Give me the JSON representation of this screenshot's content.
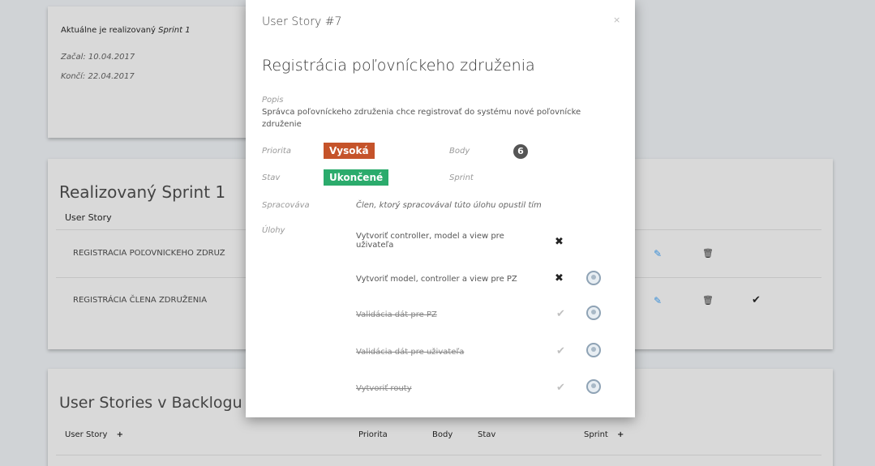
{
  "sprint_card": {
    "current_prefix": "Aktuálne je realizovaný",
    "current_sprint": "Sprint 1",
    "start": "Začal: 10.04.2017",
    "end": "Končí: 22.04.2017"
  },
  "realized": {
    "title": "Realizovaný Sprint 1",
    "col_user_story": "User Story",
    "rows": [
      {
        "name": "REGISTRÁCIA POĽOVNÍCKEHO ZDRUŽ",
        "edit": "edit-icon",
        "delete": "trash-icon",
        "check": ""
      },
      {
        "name": "REGISTRÁCIA ČLENA ZDRUŽENIA",
        "edit": "edit-icon",
        "delete": "trash-icon",
        "check": "✔"
      }
    ]
  },
  "backlog": {
    "title": "User Stories v Backlogu",
    "col_user_story": "User Story",
    "col_priority": "Priorita",
    "col_points": "Body",
    "col_state": "Stav",
    "col_sprint": "Sprint",
    "sort_icon": "+"
  },
  "modal": {
    "header": "User Story #7",
    "close": "×",
    "title": "Registrácia poľovníckeho združenia",
    "desc_label": "Popis",
    "desc_line1": "Správca poľovníckeho združenia chce registrovať do systému nové poľovnícke",
    "desc_line2": "združenie",
    "priority_label": "Priorita",
    "priority_value": "Vysoká",
    "points_label": "Body",
    "points_value": "6",
    "state_label": "Stav",
    "state_value": "Ukončené",
    "sprint_label": "Sprint",
    "assignee_label": "Spracováva",
    "assignee_value": "Člen, ktorý spracovával túto úlohu opustil tím",
    "tasks_label": "Úlohy",
    "tasks": [
      {
        "line1": "Vytvoriť controller, model a view pre",
        "line2": "uživateľa",
        "mark": "✖",
        "done": false,
        "avatar": false
      },
      {
        "line1": "Vytvoriť model, controller a view pre PZ",
        "line2": "",
        "mark": "✖",
        "done": false,
        "avatar": true
      },
      {
        "line1": "Validácia dát pre PZ",
        "line2": "",
        "mark": "✔",
        "done": true,
        "avatar": true
      },
      {
        "line1": "Validácia dát pre uživateľa",
        "line2": "",
        "mark": "✔",
        "done": true,
        "avatar": true
      },
      {
        "line1": "Vytvoriť routy",
        "line2": "",
        "mark": "✔",
        "done": true,
        "avatar": true
      }
    ]
  },
  "colors": {
    "priority_high": "#c5532a",
    "state_done": "#2bab6c",
    "edit_icon": "#3a8fd8"
  }
}
